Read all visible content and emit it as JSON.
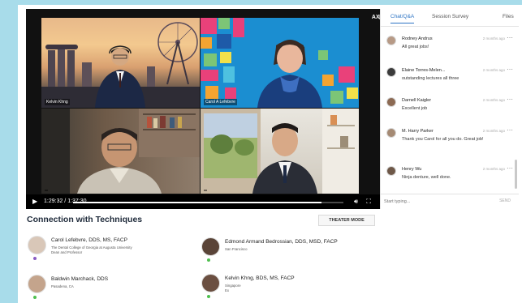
{
  "player": {
    "time_display": "1:29:32 / 1:37:30",
    "progress_fraction": 0.918,
    "badge": "AX▷",
    "tiles": [
      {
        "label": "Kelvin Khng",
        "scene": "singapore-skyline"
      },
      {
        "label": "Carol A Lefebvre",
        "scene": "colorful-pattern"
      },
      {
        "label": "",
        "scene": "office-bookshelf"
      },
      {
        "label": "",
        "scene": "home-window"
      }
    ]
  },
  "panel": {
    "tabs": [
      "Chat/Q&A",
      "Session Survey",
      "Files"
    ],
    "messages": [
      {
        "name": "Rodney Andrus",
        "time": "2 months ago",
        "text": "All great jobs!"
      },
      {
        "name": "Elaine Torres-Melen...",
        "time": "2 months ago",
        "text": "outstanding lectures all three"
      },
      {
        "name": "Darnell Kaigler",
        "time": "2 months ago",
        "text": "Excellent job"
      },
      {
        "name": "M. Harry Parker",
        "time": "2 months ago",
        "text": "Thank you Carol for all you do. Great job!"
      },
      {
        "name": "Henry Wu",
        "time": "2 months ago",
        "text": "Ninja denture, well done."
      }
    ],
    "input_placeholder": "Start typing...",
    "send_label": "SEND",
    "more_icon": "⋯"
  },
  "section": {
    "title": "Connection with Techniques",
    "theater_label": "THEATER MODE"
  },
  "speakers": [
    {
      "name": "Carol Lefebvre, DDS, MS, FACP",
      "sub1": "The Dental College of Georgia at Augusta University",
      "sub2": "Dean and Professor",
      "dot_color": "#8a5cc4"
    },
    {
      "name": "Edmond Armand Bedrossian, DDS, MSD, FACP",
      "sub1": "San Francisco",
      "sub2": "",
      "dot_color": "#4fbf4f"
    },
    {
      "name": "Baldwin Marchack, DDS",
      "sub1": "Pasadena, CA",
      "sub2": "",
      "dot_color": "#4fbf4f"
    },
    {
      "name": "Kelvin Khng, BDS, MS, FACP",
      "sub1": "Singapore",
      "sub2": "Ex",
      "dot_color": "#4fbf4f"
    }
  ],
  "colors": {
    "accent": "#2d74c4",
    "background": "#a8dcea"
  }
}
